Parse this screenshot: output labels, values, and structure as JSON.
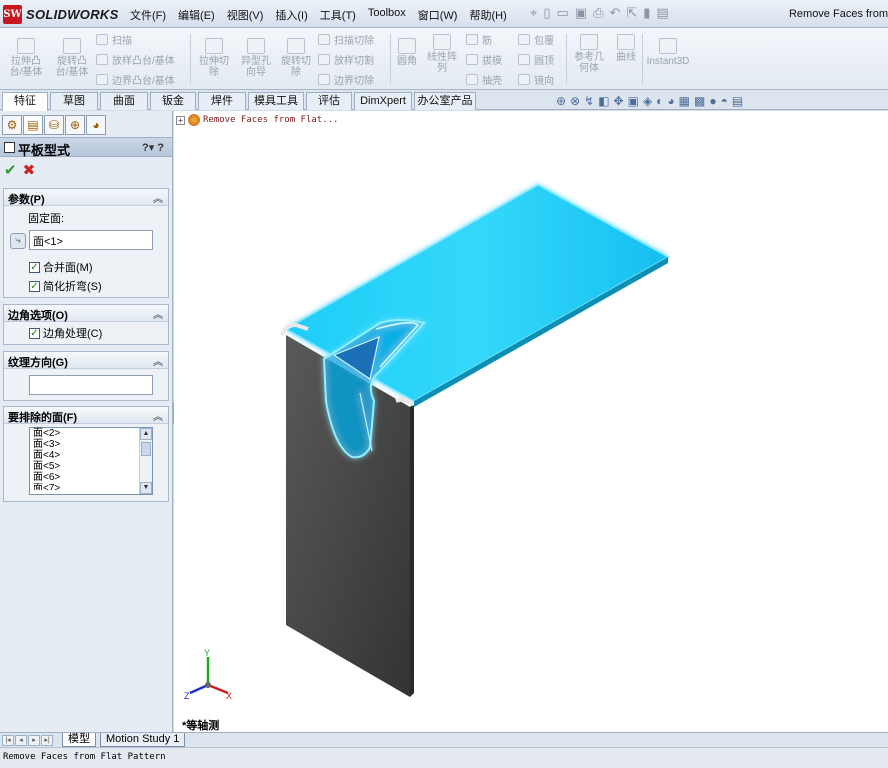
{
  "app": {
    "logo_mark": "SW",
    "logo_text": "SOLIDWORKS",
    "window_title": "Remove Faces from"
  },
  "menu": [
    "文件(F)",
    "编辑(E)",
    "视图(V)",
    "插入(I)",
    "工具(T)",
    "Toolbox",
    "窗口(W)",
    "帮助(H)"
  ],
  "ribbon": {
    "extrude_boss": "拉伸凸\n台/基体",
    "revolve_boss": "旋转凸\n台/基体",
    "sweep": "扫描",
    "loft_boss": "放样凸台/基体",
    "boundary_boss": "边界凸台/基体",
    "extrude_cut": "拉伸切\n除",
    "hole_wizard": "异型孔\n向导",
    "revolve_cut": "旋转切\n除",
    "sweep_cut": "扫描切除",
    "loft_cut": "放样切割",
    "boundary_cut": "边界切除",
    "fillet": "圆角",
    "linear_pattern": "线性阵\n列",
    "rib": "筋",
    "draft": "拔模",
    "shell": "抽壳",
    "wrap": "包覆",
    "dome": "圆顶",
    "mirror": "镜向",
    "ref_geometry": "参考几\n何体",
    "curves": "曲线",
    "instant3d": "Instant3D"
  },
  "tabs": [
    "特征",
    "草图",
    "曲面",
    "钣金",
    "焊件",
    "模具工具",
    "评估",
    "DimXpert",
    "办公室产品"
  ],
  "property_manager": {
    "title": "平板型式",
    "help": "?",
    "help2": "?",
    "ok": "✔",
    "cancel": "✖",
    "params": {
      "heading": "参数(P)",
      "fixed_face_label": "固定面:",
      "fixed_face_value": "面<1>",
      "merge_faces": "合并面(M)",
      "simplify_bends": "简化折弯(S)"
    },
    "corner": {
      "heading": "边角选项(O)",
      "corner_treatment": "边角处理(C)"
    },
    "grain": {
      "heading": "纹理方向(G)",
      "value": ""
    },
    "exclude": {
      "heading": "要排除的面(F)",
      "faces": [
        "面<2>",
        "面<3>",
        "面<4>",
        "面<5>",
        "面<6>",
        "面<7>"
      ]
    }
  },
  "viewport": {
    "tree_text": "Remove Faces from Flat...",
    "view_label": "*等轴测",
    "axis_x": "X",
    "axis_y": "Y",
    "axis_z": "Z"
  },
  "bottom_tabs": [
    "模型",
    "Motion Study 1"
  ],
  "status_text": "Remove Faces from Flat Pattern",
  "colors": {
    "highlight": "#00c8f5",
    "part": "#4a4a4a",
    "accent_red": "#c8171e"
  }
}
